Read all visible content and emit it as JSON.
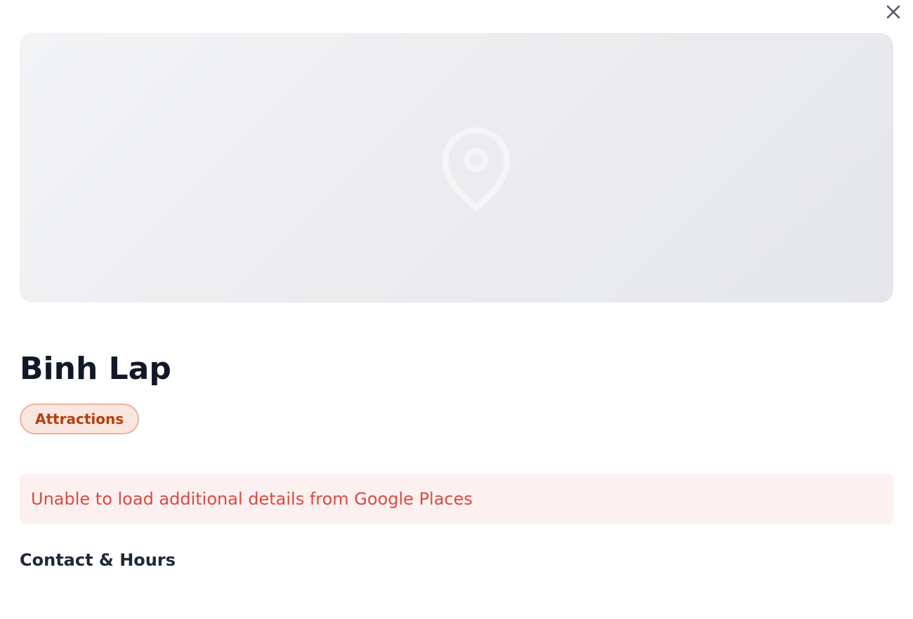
{
  "modal": {
    "close_icon": "close-icon",
    "hero": {
      "placeholder_icon": "map-pin-icon",
      "background_from": "#f3f4f6",
      "background_to": "#e5e7eb"
    },
    "place": {
      "name": "Binh Lap",
      "category": "Attractions"
    },
    "error": {
      "message": "Unable to load additional details from Google Places"
    },
    "sections": {
      "contact_hours": "Contact & Hours"
    }
  },
  "colors": {
    "title": "#111827",
    "badge_text": "#b2410e",
    "badge_bg": "#f9e6de",
    "badge_border": "#e8b4a0",
    "error_text": "#dc4a40",
    "error_bg": "#fdf0f0"
  }
}
